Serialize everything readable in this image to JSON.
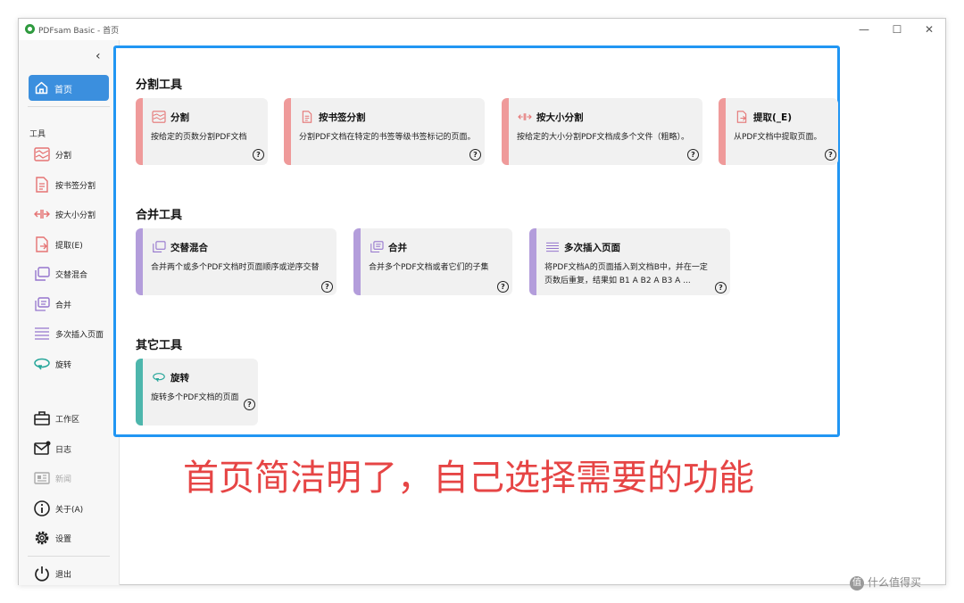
{
  "window": {
    "title": "PDFsam Basic - 首页",
    "controls": [
      "—",
      "☐",
      "✕"
    ]
  },
  "sidebar": {
    "collapse": "‹",
    "home": "首页",
    "tools_label": "工具",
    "tools": [
      "分割",
      "按书签分割",
      "按大小分割",
      "提取(E)",
      "交替混合",
      "合并",
      "多次插入页面",
      "旋转"
    ],
    "bottom": [
      "工作区",
      "日志",
      "新闻",
      "关于(A)",
      "设置"
    ],
    "exit": "退出"
  },
  "main": {
    "groups": [
      {
        "title": "分割工具",
        "cards": [
          {
            "title": "分割",
            "desc": "按给定的页数分割PDF文档"
          },
          {
            "title": "按书签分割",
            "desc": "分割PDF文档在特定的书签等级书签标记的页面。"
          },
          {
            "title": "按大小分割",
            "desc": "按给定的大小分割PDF文档成多个文件（粗略）。"
          },
          {
            "title": "提取(_E)",
            "desc": "从PDF文档中提取页面。"
          }
        ]
      },
      {
        "title": "合并工具",
        "cards": [
          {
            "title": "交替混合",
            "desc": "合并两个或多个PDF文档时页面顺序或逆序交替"
          },
          {
            "title": "合并",
            "desc": "合并多个PDF文档或者它们的子集"
          },
          {
            "title": "多次插入页面",
            "desc": "将PDF文档A的页面插入到文档B中，并在一定页数后重复，结果如 B1 A B2 A B3 A ..."
          }
        ]
      },
      {
        "title": "其它工具",
        "cards": [
          {
            "title": "旋转",
            "desc": "旋转多个PDF文档的页面"
          }
        ]
      }
    ],
    "help_glyph": "?"
  },
  "annotation": "首页简洁明了，自己选择需要的功能",
  "watermark": {
    "glyph": "值",
    "text": "什么值得买"
  },
  "colors": {
    "split": "#ef9a9a",
    "merge": "#b39ddb",
    "other": "#4db6ac",
    "accent": "#3b8fde",
    "frame": "#2196f3",
    "annotation": "#e64545"
  }
}
